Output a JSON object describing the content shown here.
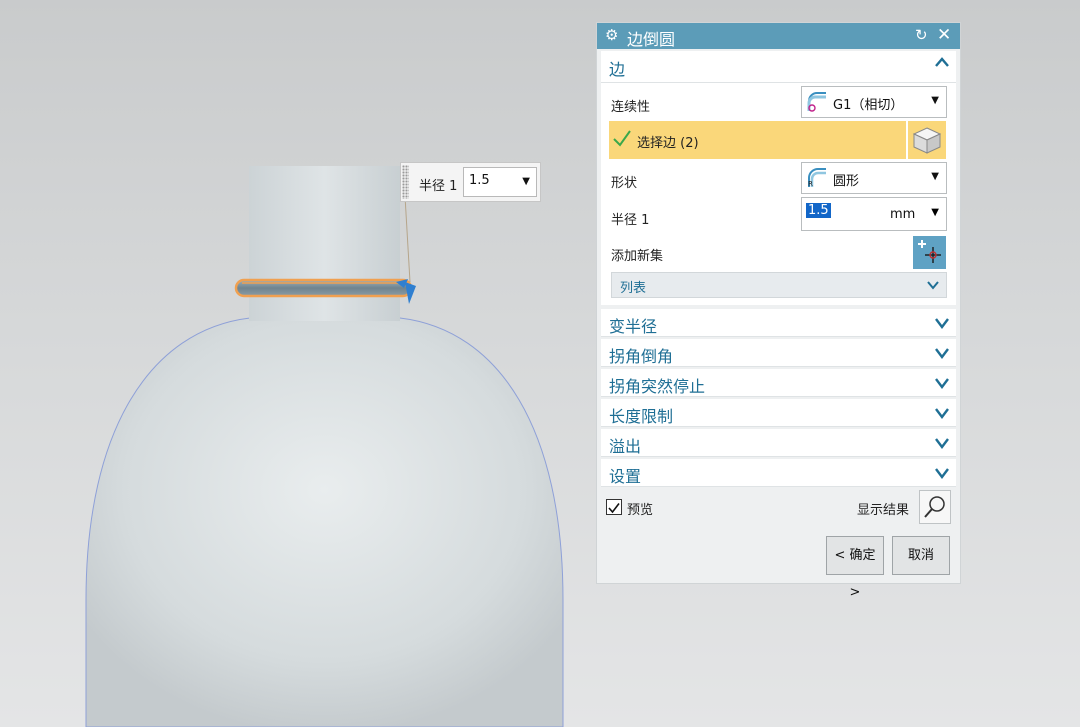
{
  "floating_radius": {
    "label": "半径 1",
    "value": "1.5"
  },
  "dialog": {
    "title": "边倒圆",
    "edge_section": {
      "title": "边",
      "continuity_label": "连续性",
      "continuity_value": "G1（相切）",
      "select_edge_label": "选择边 (2)",
      "shape_label": "形状",
      "shape_value": "圆形",
      "radius_label": "半径 1",
      "radius_value": "1.5",
      "radius_unit": "mm",
      "add_set_label": "添加新集",
      "list_label": "列表"
    },
    "collapsed_sections": [
      "变半径",
      "拐角倒角",
      "拐角突然停止",
      "长度限制",
      "溢出",
      "设置"
    ],
    "preview_label": "预览",
    "preview_checked": true,
    "show_result_label": "显示结果",
    "ok_label": "< 确定 >",
    "cancel_label": "取消"
  },
  "colors": {
    "title_bar": "#5c9cb8",
    "section_text": "#1f6f95",
    "selection_highlight": "#fad77a",
    "edge_highlight": "#f0a050"
  }
}
